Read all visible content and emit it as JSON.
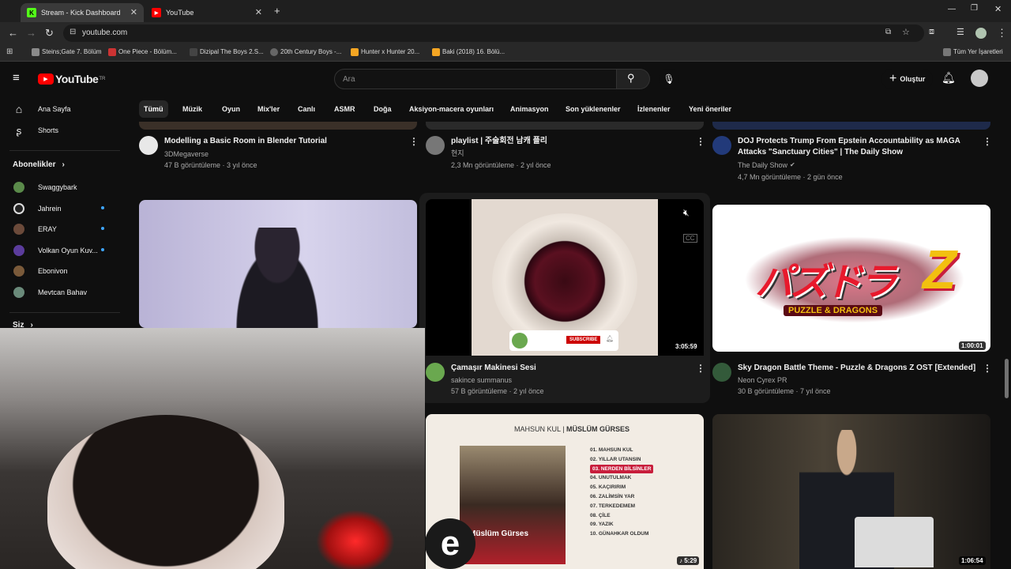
{
  "browser": {
    "tabs": [
      {
        "title": "Stream - Kick Dashboard"
      },
      {
        "title": "YouTube"
      }
    ],
    "url": "youtube.com",
    "bookmarks": [
      "Steins;Gate 7. Bölüm",
      "One Piece - Bölüm...",
      "Dizipal The Boys 2.S...",
      "20th Century Boys -...",
      "Hunter x Hunter 20...",
      "Baki (2018) 16. Bölü..."
    ],
    "all_bookmarks": "Tüm Yer İşaretleri"
  },
  "header": {
    "logo": "YouTube",
    "logo_sup": "TR",
    "search_placeholder": "Ara",
    "create_label": "Oluştur"
  },
  "chips": [
    "Tümü",
    "Müzik",
    "Oyun",
    "Mix'ler",
    "Canlı",
    "ASMR",
    "Doğa",
    "Aksiyon-macera oyunları",
    "Animasyon",
    "Son yüklenenler",
    "İzlenenler",
    "Yeni öneriler"
  ],
  "sidebar": {
    "home": "Ana Sayfa",
    "shorts": "Shorts",
    "subscriptions_title": "Abonelikler",
    "subscriptions": [
      "Swaggybark",
      "Jahrein",
      "ERAY",
      "Volkan Oyun Kuv...",
      "Ebonivon",
      "Mevtcan Bahav"
    ],
    "you": "Siz"
  },
  "videos_top": [
    {
      "title": "Modelling a Basic Room in Blender Tutorial",
      "channel": "3DMegaverse",
      "meta": "47 B görüntüleme · 3 yıl önce"
    },
    {
      "title": "playlist | 주술회전 남캐 플리",
      "channel": "현지",
      "meta": "2,3 Mn görüntüleme · 2 yıl önce"
    },
    {
      "title": "DOJ Protects Trump From Epstein Accountability as MAGA Attacks \"Sanctuary Cities\" | The Daily Show",
      "channel": "The Daily Show",
      "meta": "4,7 Mn görüntüleme · 2 gün önce"
    }
  ],
  "videos_mid": [
    {
      "title": "Çamaşır Makinesi Sesi",
      "channel": "sakince summanus",
      "meta": "57 B görüntüleme · 2 yıl önce",
      "duration": "3:05:59",
      "subscribe_label": "SUBSCRIBE"
    },
    {
      "title": "Sky Dragon Battle Theme - Puzzle & Dragons Z OST [Extended]",
      "channel": "Neon Cyrex PR",
      "meta": "30 B görüntüleme · 7 yıl önce",
      "duration": "1:00:01",
      "thumb_text_jp": "パズドラ",
      "thumb_text_en": "PUZZLE & DRAGONS"
    }
  ],
  "album": {
    "artist1": "MAHSUN KUL",
    "artist2": "MÜSLÜM GÜRSES",
    "tracks": [
      "01. MAHSUN KUL",
      "02. YILLAR UTANSIN",
      "03. NERDEN BİLSİNLER",
      "04. UNUTULMAK",
      "05. KAÇIRIRIM",
      "06. ZALİMSİN YAR",
      "07. TERKEDEMEM",
      "08. ÇİLE",
      "09. YAZIK",
      "10. GÜNAHKAR OLDUM"
    ],
    "cover_text": "Müslüm Gürses",
    "duration": "5:29"
  },
  "last_duration": "1:06:54",
  "colors": {
    "bg": "#0f0f0f",
    "accent_red": "#ff0000",
    "kick_green": "#53fc18"
  }
}
